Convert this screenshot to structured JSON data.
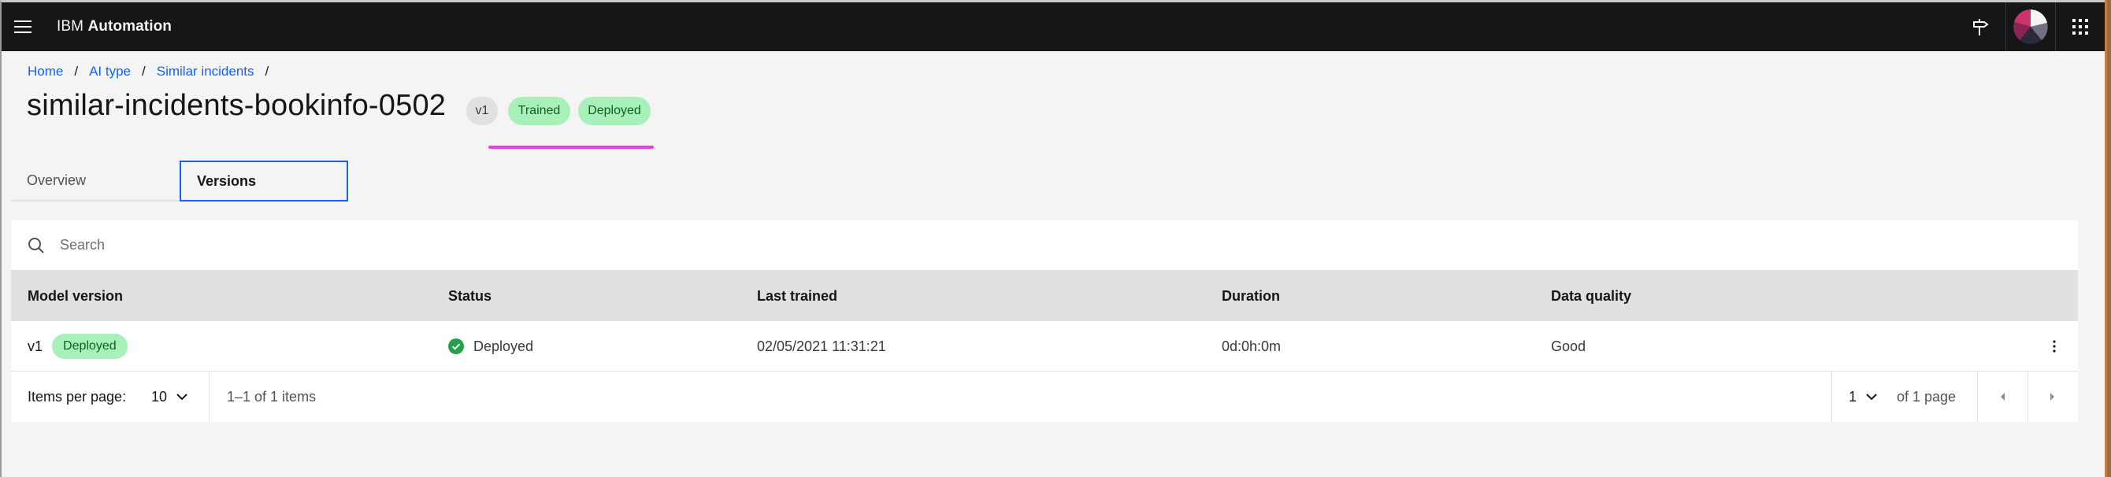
{
  "header": {
    "brand_light": "IBM ",
    "brand_bold": "Automation",
    "icons": [
      "menu-icon",
      "signpost-icon",
      "user-avatar",
      "app-switcher-icon"
    ]
  },
  "breadcrumb": [
    {
      "label": "Home"
    },
    {
      "label": "AI type"
    },
    {
      "label": "Similar incidents"
    }
  ],
  "breadcrumb_separator": "/",
  "page": {
    "title": "similar-incidents-bookinfo-0502",
    "version_tag": "v1",
    "tags": [
      "Trained",
      "Deployed"
    ]
  },
  "tabs": [
    {
      "label": "Overview",
      "selected": false
    },
    {
      "label": "Versions",
      "selected": true
    }
  ],
  "search": {
    "placeholder": "Search",
    "value": ""
  },
  "table": {
    "columns": [
      "Model version",
      "Status",
      "Last trained",
      "Duration",
      "Data quality"
    ],
    "rows": [
      {
        "version": "v1",
        "version_tag": "Deployed",
        "status": "Deployed",
        "last_trained": "02/05/2021 11:31:21",
        "duration": "0d:0h:0m",
        "data_quality": "Good"
      }
    ]
  },
  "pagination": {
    "items_per_page_label": "Items per page:",
    "items_per_page": "10",
    "range": "1–1 of 1 items",
    "page": "1",
    "of_pages": "of 1 page"
  },
  "colors": {
    "header_bg": "#161616",
    "link": "#0f62fe",
    "tag_green_bg": "#a7f0ba",
    "tag_green_text": "#0e6027",
    "status_success": "#24a148",
    "highlight": "#e342e3"
  }
}
